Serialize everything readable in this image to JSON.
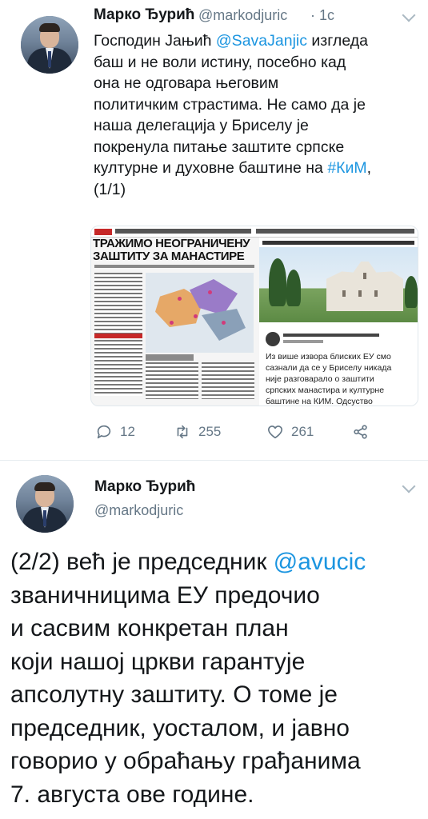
{
  "tweet1": {
    "author_name": "Марко Ђурић",
    "handle": "@markodjuric",
    "time": "· 1c",
    "text_lines": [
      [
        {
          "t": "Господин Јањић "
        },
        {
          "t": "@SavaJanjic",
          "link": true
        },
        {
          "t": " изгледа"
        }
      ],
      [
        {
          "t": "баш и не воли истину, посебно кад"
        }
      ],
      [
        {
          "t": "она не одговара његовим"
        }
      ],
      [
        {
          "t": "политичким страстима. Не само да је"
        }
      ],
      [
        {
          "t": "наша делегација у Бриселу је"
        }
      ],
      [
        {
          "t": "покренула питање заштите српске"
        }
      ],
      [
        {
          "t": "културне и духовне баштине на "
        },
        {
          "t": "#КиМ",
          "link": true
        },
        {
          "t": ","
        }
      ],
      [
        {
          "t": "(1/1)"
        }
      ]
    ],
    "media": {
      "headline_lines": [
        "ТРАЖИМО НЕОГРАНИЧЕНУ",
        "ЗАШТИТУ ЗА МАНАСТИРЕ"
      ],
      "quote_lines": [
        "Из више извора блиских ЕУ смо",
        "сазнали да се у Бриселу никада",
        "није разговарало о заштити",
        "српских манастира и културне",
        "баштине на КИМ. Одсуство"
      ]
    },
    "actions": {
      "replies": "12",
      "retweets": "255",
      "likes": "261"
    }
  },
  "tweet2": {
    "author_name": "Марко Ђурић",
    "handle": "@markodjuric",
    "text_lines": [
      [
        {
          "t": "(2/2) већ је председник "
        },
        {
          "t": "@avucic",
          "link": true
        }
      ],
      [
        {
          "t": "званичницима ЕУ предочио"
        }
      ],
      [
        {
          "t": "и сасвим конкретан план"
        }
      ],
      [
        {
          "t": "који нашој цркви гарантује"
        }
      ],
      [
        {
          "t": "апсолутну заштиту. О томе је"
        }
      ],
      [
        {
          "t": "председник, уосталом, и јавно"
        }
      ],
      [
        {
          "t": "говорио у обраћању грађанима"
        }
      ],
      [
        {
          "t": "7. августа ове године."
        }
      ]
    ]
  },
  "colors": {
    "link": "#1b95e0",
    "muted": "#657786",
    "text": "#14171a"
  }
}
